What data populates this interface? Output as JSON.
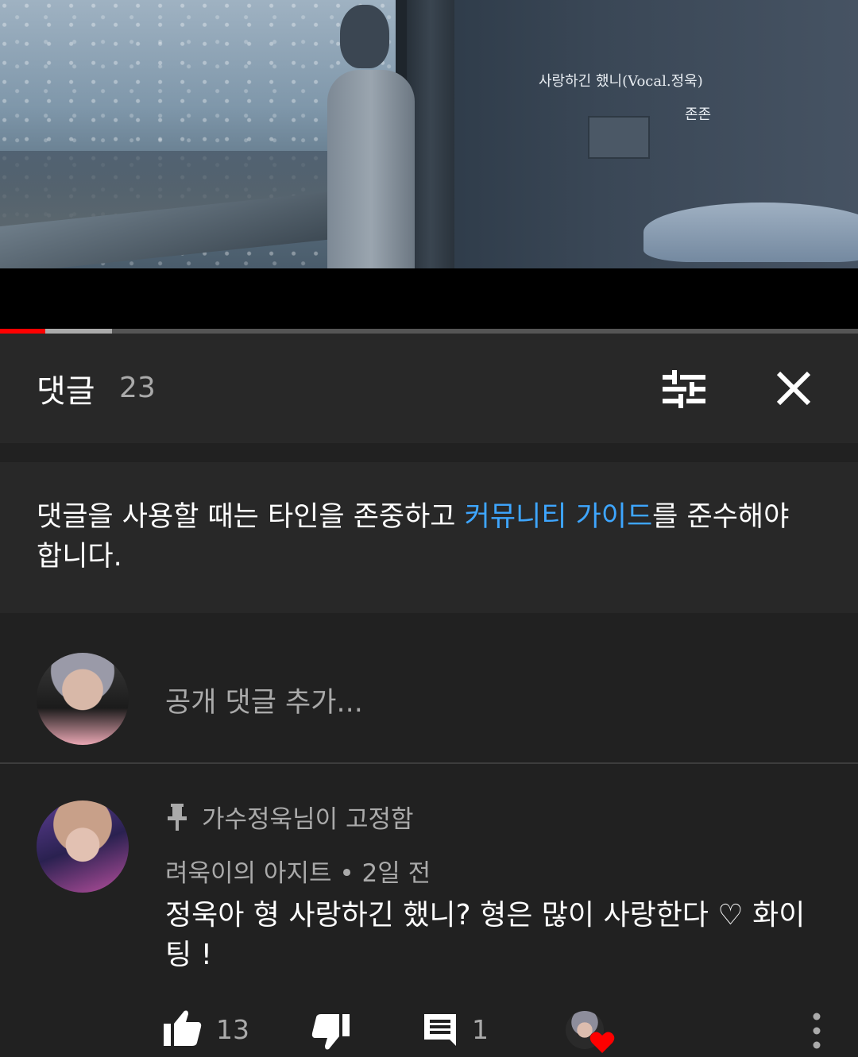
{
  "video": {
    "song_title": "사랑하긴 했니(Vocal.정욱)",
    "artist": "존존",
    "progress": {
      "played_fraction": 0.053,
      "buffered_fraction": 0.131
    }
  },
  "comments_header": {
    "title": "댓글",
    "count": "23",
    "icons": {
      "sort": "sort-icon",
      "close": "close-icon"
    }
  },
  "guideline": {
    "text_before": "댓글을 사용할 때는 타인을 존중하고 ",
    "link_text": "커뮤니티 가이드",
    "text_after": "를 준수해야 합니다.",
    "link_color": "#3ea6ff"
  },
  "add_comment": {
    "placeholder": "공개 댓글 추가..."
  },
  "pinned_comment": {
    "pinned_label": "가수정욱님이 고정함",
    "author": "려욱이의 아지트",
    "separator": "•",
    "time": "2일 전",
    "text": "정욱아 형 사랑하긴 했니? 형은 많이 사랑한다 ♡ 화이팅 !",
    "likes": "13",
    "replies": "1",
    "icons": [
      "pin-icon",
      "like-icon",
      "dislike-icon",
      "reply-icon",
      "creator-heart-icon",
      "more-icon"
    ],
    "heart_color": "#ff0000"
  }
}
